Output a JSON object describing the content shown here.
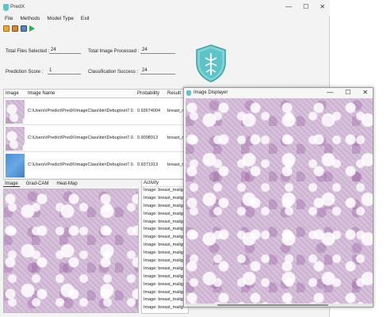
{
  "window": {
    "title": "PredX",
    "controls": {
      "minimize": "—",
      "maximize": "☐",
      "close": "✕"
    }
  },
  "menu": [
    "File",
    "Methods",
    "Model Type",
    "Exit"
  ],
  "toolbar_icons": [
    "open-folder-icon",
    "save-icon",
    "disk-icon",
    "run-icon"
  ],
  "stats": {
    "total_files_label": "Total Files Selected :",
    "total_files_value": "24",
    "total_processed_label": "Total Image Processed :",
    "total_processed_value": "24",
    "prediction_score_label": "Prediction Score :",
    "prediction_score_value": "1",
    "classification_success_label": "Classification Success :",
    "classification_success_value": "24"
  },
  "grid": {
    "headers": [
      "Image",
      "Image Name",
      "Probability",
      "Result"
    ],
    "rows": [
      {
        "name": "C:\\Users\\rPredict\\PredX\\ImageClass\\bin\\Debug\\net7.0...",
        "probability": "0.93674004",
        "result": "breast_m",
        "thumb": "tissue"
      },
      {
        "name": "C:\\Users\\rPredict\\PredX\\ImageClass\\bin\\Debug\\net7.0...",
        "probability": "0.9098913",
        "result": "breast_m",
        "thumb": "tissue"
      },
      {
        "name": "C:\\Users\\rPredict\\PredX\\ImageClass\\bin\\Debug\\net7.0...",
        "probability": "0.9371913",
        "result": "breast_m",
        "thumb": "blue"
      }
    ]
  },
  "tabs": [
    "Image",
    "Grad-CAM",
    "Heat-Map"
  ],
  "activity": {
    "title": "Activity",
    "items": [
      "Image: breast_malig",
      "Image: breast_malig",
      "Image: breast_malig",
      "Image: breast_malig",
      "Image: breast_malig",
      "Image: breast_malig",
      "Image: breast_malig",
      "Image: breast_malig",
      "Image: breast_malig",
      "Image: breast_malig",
      "Image: breast_malig",
      "Image: breast_malig",
      "Image: breast_malig",
      "Image: breast_malig",
      "Image: breast_malig",
      "Image: breast_malig"
    ]
  },
  "displayer": {
    "title": "Image Displayer",
    "controls": {
      "minimize": "—",
      "maximize": "☐",
      "close": "✕"
    }
  },
  "colors": {
    "accent": "#5cc3c6",
    "tissue": "#d7c3dc"
  }
}
